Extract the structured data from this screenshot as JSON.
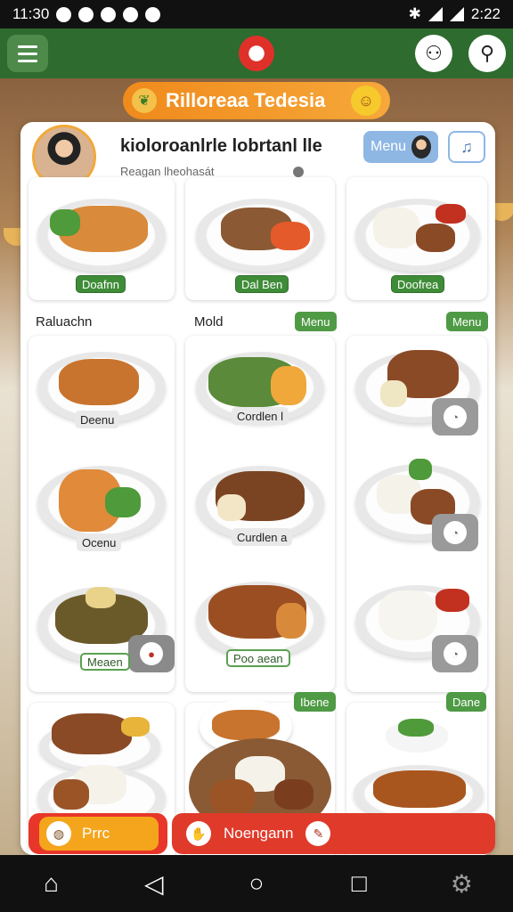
{
  "status": {
    "time": "11:30",
    "right_time": "2:22"
  },
  "banner": {
    "title": "Rilloreaa Tedesia"
  },
  "profile": {
    "name": "kioloroanlrle lobrtanl lle",
    "subtitle": "Reagan lheohasát",
    "menu_label": "Menu"
  },
  "sections": {
    "left": "Raluachn",
    "mid": "Mold",
    "mid_chip": "Menu",
    "right_chip": "Menu"
  },
  "tiles": {
    "t1": "Doafnn",
    "t2": "Dal Ben",
    "t3": "Doofrea",
    "t4": "Deenu",
    "t5": "Cordlen l",
    "t7": "Ocenu",
    "t8": "Curdlen a",
    "t10": "Meaen",
    "t11": "Poo aean",
    "t13": "Ibene",
    "t15": "Dane"
  },
  "buttons": {
    "left": "Prrc",
    "right": "Noengann"
  },
  "colors": {
    "appbar": "#2e6b2f",
    "accent_orange": "#f08a1c",
    "accent_red": "#e03a2a",
    "label_green": "#3f8c38"
  }
}
